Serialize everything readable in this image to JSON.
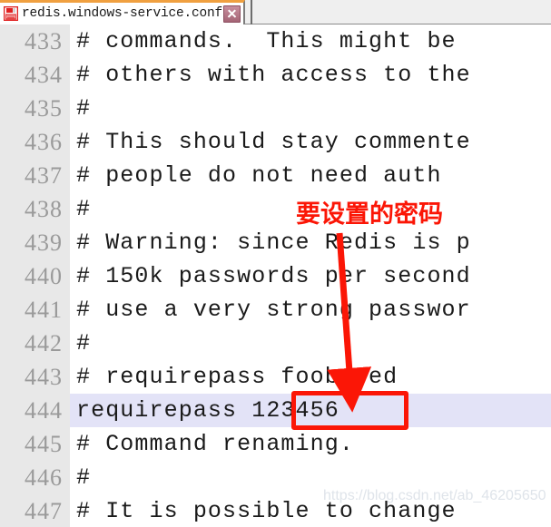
{
  "window": {
    "tab": {
      "title": "redis.windows-service.conf",
      "save_icon": "floppy-disk-icon",
      "close_icon": "close-icon",
      "active_accent": "#f0a040"
    },
    "tabstrip_bg": "#efefef"
  },
  "editor": {
    "gutter_bg": "#e8e8e8",
    "lineno_color": "#9a9a9a",
    "highlight_color": "#e3e3f7",
    "first_line": 433,
    "lines": [
      {
        "num": "433",
        "text": "# commands.  This might be",
        "highlighted": false
      },
      {
        "num": "434",
        "text": "# others with access to the",
        "highlighted": false
      },
      {
        "num": "435",
        "text": "#",
        "highlighted": false
      },
      {
        "num": "436",
        "text": "# This should stay commente",
        "highlighted": false
      },
      {
        "num": "437",
        "text": "# people do not need auth",
        "highlighted": false
      },
      {
        "num": "438",
        "text": "#",
        "highlighted": false
      },
      {
        "num": "439",
        "text": "# Warning: since Redis is p",
        "highlighted": false
      },
      {
        "num": "440",
        "text": "# 150k passwords per second",
        "highlighted": false
      },
      {
        "num": "441",
        "text": "# use a very strong passwor",
        "highlighted": false
      },
      {
        "num": "442",
        "text": "#",
        "highlighted": false
      },
      {
        "num": "443",
        "text": "# requirepass foobared",
        "highlighted": false
      },
      {
        "num": "444",
        "text": "requirepass 123456",
        "highlighted": true
      },
      {
        "num": "445",
        "text": "# Command renaming.",
        "highlighted": false
      },
      {
        "num": "446",
        "text": "#",
        "highlighted": false
      },
      {
        "num": "447",
        "text": "# It is possible to change",
        "highlighted": false
      }
    ]
  },
  "annotation": {
    "note_text": "要设置的密码",
    "note_color": "#fb1606",
    "arrow_color": "#fb1606",
    "highlight_box_target": "123456",
    "box_color": "#fb1606"
  },
  "watermark": {
    "text": "https://blog.csdn.net/ab_46205650"
  }
}
